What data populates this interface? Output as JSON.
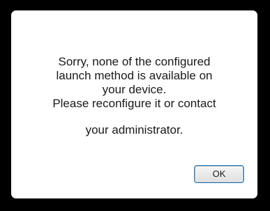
{
  "dialog": {
    "message_lines": [
      "Sorry, none of the configured",
      "launch method is available on",
      "your device.",
      "Please reconfigure it or contact"
    ],
    "message_last_line": "your administrator.",
    "ok_label": "OK"
  }
}
